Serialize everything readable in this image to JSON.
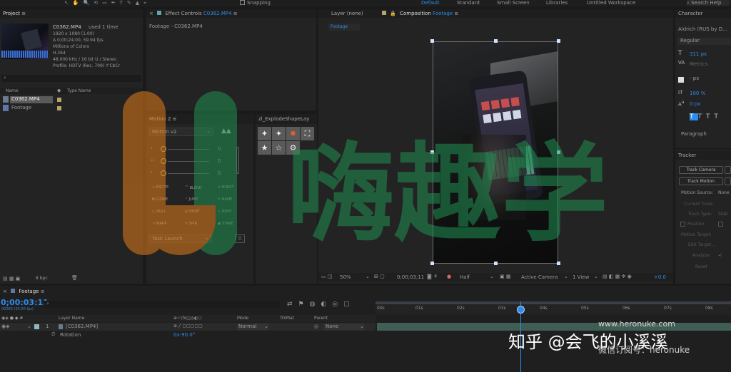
{
  "topbar": {
    "snapping": "Snapping",
    "workspaces": [
      "Default",
      "Standard",
      "Small Screen",
      "Libraries",
      "Untitled Workspace"
    ],
    "search_help": "Search Help"
  },
  "project": {
    "title": "Project",
    "file_name": "C0362.MP4",
    "used": "used 1 time",
    "info": [
      "1920 x 1080 (1.00)",
      "Δ 0;00;24;00, 59.94 fps",
      "Millions of Colors",
      "H.264",
      "48.000 kHz / 16 bit U / Stereo",
      "Profile: HDTV (Rec. 709) Y'CbCr"
    ],
    "col_name": "Name",
    "col_type": "Type Name",
    "items": [
      "C0362.MP4",
      "Footage"
    ],
    "bpc": "8 bpc"
  },
  "effect_controls": {
    "title": "Effect Controls",
    "clip": "C0362.MP4",
    "subtitle": "Footage - C0362.MP4"
  },
  "motion2": {
    "title": "Motion 2",
    "dropdown": "Motion v2",
    "values": [
      "0",
      "0",
      "0"
    ],
    "buttons": [
      "EXCITE",
      "BLEND",
      "BURST",
      "CLONE",
      "JUMP",
      "NAME",
      "NULL",
      "ORBIT",
      "ROPE",
      "WARP",
      "SPIN",
      "STARE"
    ],
    "task": "Task Launch"
  },
  "explode": {
    "title": "zl_ExplodeShapeLay"
  },
  "layer_panel": {
    "title": "Layer (none)"
  },
  "composition": {
    "title": "Composition",
    "name": "Footage",
    "tab": "Footage",
    "zoom": "50%",
    "timecode": "0;00;03;11",
    "resolution": "Half",
    "camera": "Active Camera",
    "view": "1 View",
    "exposure": "+0.0"
  },
  "character": {
    "title": "Character",
    "font": "Aldrich (RUS by D...",
    "style": "Regular",
    "size": "311 px",
    "kerning": "Metrics",
    "leading": "- px",
    "scale": "100 %",
    "baseline": "0 px",
    "paragraph": "Paragraph"
  },
  "tracker": {
    "title": "Tracker",
    "buttons": [
      "Track Camera",
      "Track Motion"
    ],
    "motion_source": "Motion Source:",
    "source_value": "None",
    "current_track": "Current Track:",
    "track_type": "Track Type:",
    "track_type_value": "Stab",
    "position": "Position",
    "motion_target": "Motion Target:",
    "edit_target": "Edit Target...",
    "analyze": "Analyze:",
    "reset": "Reset"
  },
  "timeline": {
    "tab": "Footage",
    "timecode": "0;00:03:11",
    "frames": "00083 (24.00 fps)",
    "col_layer": "Layer Name",
    "col_mode": "Mode",
    "col_trkmat": "TrkMat",
    "col_parent": "Parent",
    "layer_num": "1",
    "layer_name": "[C0362.MP4]",
    "mode": "Normal",
    "parent": "None",
    "rotation_label": "Rotation",
    "rotation_value": "0x-90.0°",
    "ruler": [
      "00s",
      "01s",
      "02s",
      "03s",
      "04s",
      "05s",
      "06s",
      "07s",
      "08s"
    ]
  },
  "watermarks": {
    "center_logo": "嗨趣学",
    "url": "www.heronuke.com",
    "zhihu": "知乎 @会飞的小溪溪",
    "wechat": "微信订阅号：heronuke"
  },
  "colors": {
    "accent": "#2d8ceb",
    "logo_orange": "#e07b1a",
    "logo_green": "#1f8f52"
  }
}
